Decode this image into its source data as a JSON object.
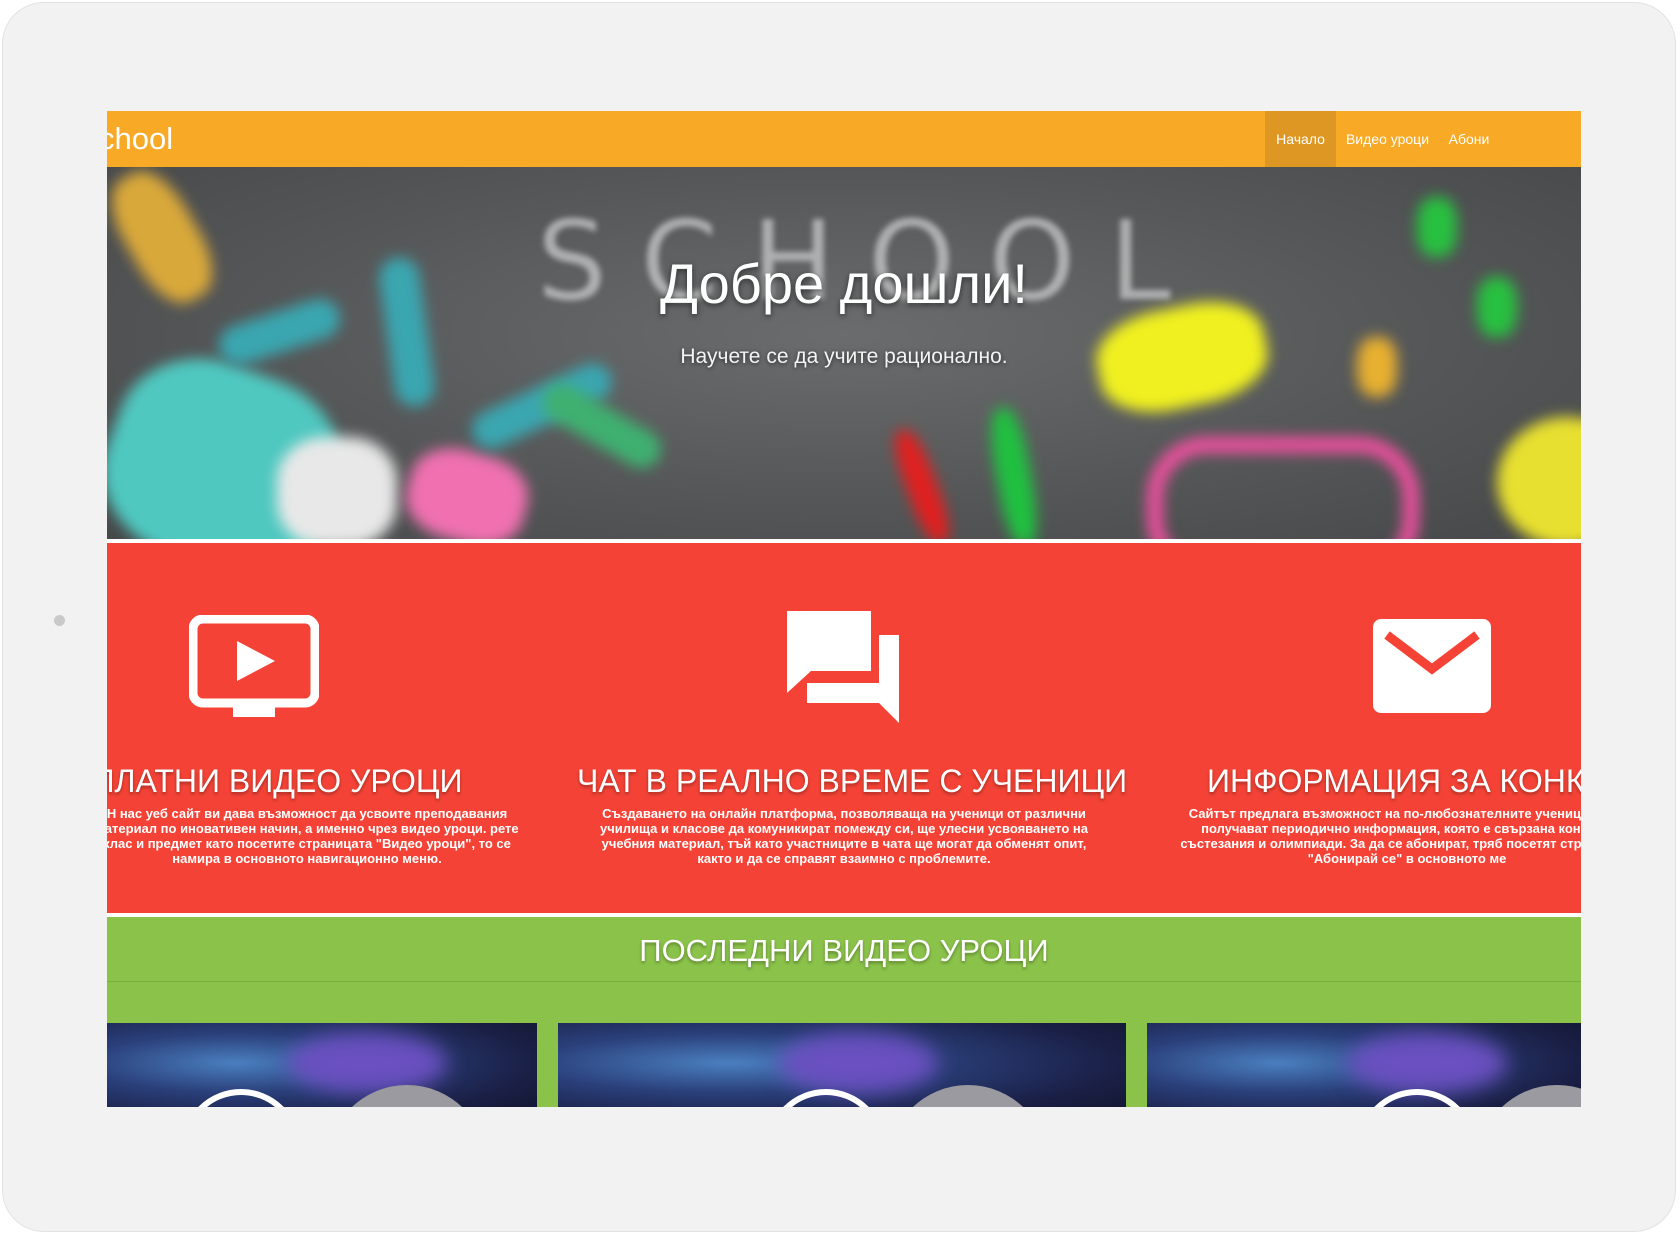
{
  "navbar": {
    "brand": "chool",
    "items": [
      {
        "label": "Начало",
        "active": true
      },
      {
        "label": "Видео уроци",
        "active": false
      },
      {
        "label": "Абони",
        "active": false
      }
    ]
  },
  "hero": {
    "background_text": "SCHOOL",
    "title": "Добре дошли!",
    "subtitle": "Научете се да учите рационално."
  },
  "features": [
    {
      "icon": "tv-play-icon",
      "title": "ПЛАТНИ ВИДЕО УРОЦИ",
      "text": "Н нас уеб сайт ви дава възможност да усвоите преподавания материал по иновативен начин, а именно чрез видео уроци. рете клас и предмет като посетите страницата \"Видео уроци\", то се намира в основното навигационно меню."
    },
    {
      "icon": "chat-bubbles-icon",
      "title": "ЧАТ В РЕАЛНО ВРЕМЕ С УЧЕНИЦИ",
      "text": "Създаването на онлайн платформа, позволяваща на ученици от различни училища и класове да комуникират помежду си, ще улесни усвояването на учебния материал, тъй като участниците в чата ще могат да обменят опит, както и да се справят взаимно с проблемите."
    },
    {
      "icon": "envelope-icon",
      "title": "ИНФОРМАЦИЯ ЗА КОНКУ",
      "text": "Сайтът предлага възможност на по-любознателните ученици за да получават периодично информация, която е свързана конкуси, състезания и олимпиади. За да се абонират, тряб посетят страницата \"Абонирай се\" в основното ме"
    }
  ],
  "latest": {
    "title": "ПОСЛЕДНИ ВИДЕО УРОЦИ"
  },
  "colors": {
    "navbar": "#f8a926",
    "navbar_active": "#dd9722",
    "features_bg": "#f44336",
    "latest_bg": "#8bc34a"
  }
}
